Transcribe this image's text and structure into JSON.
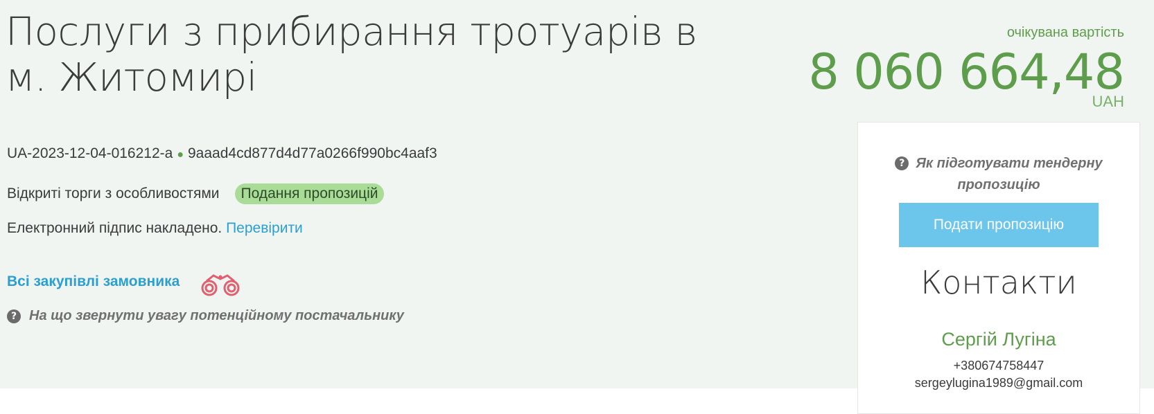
{
  "tender": {
    "title": "Послуги з прибирання тротуарів в м. Житомирі",
    "tender_id": "UA-2023-12-04-016212-a",
    "hash": "9aaad4cd877d4d77a0266f990bc4aaf3",
    "procedure_type": "Відкриті торги з особливостями",
    "status": "Подання пропозицій",
    "signature_text": "Електронний підпис накладено.",
    "signature_check_link": "Перевірити",
    "customer_purchases_link": "Всі закупівлі замовника",
    "supplier_hint": "На що звернути увагу потенційному постачальнику"
  },
  "price": {
    "label": "очікувана вартість",
    "value": "8 060 664,48",
    "currency": "UAH"
  },
  "panel": {
    "hint": "Як підготувати тендерну пропозицію",
    "submit_label": "Подати пропозицію",
    "contacts_title": "Контакти",
    "contact_name": "Сергій Лугіна",
    "contact_phone": "+380674758447",
    "contact_email": "sergeylugina1989@gmail.com"
  },
  "icons": {
    "help": "question-circle-icon",
    "watch": "binoculars-icon"
  },
  "colors": {
    "background": "#f0f5f1",
    "price_green": "#5e9d4c",
    "link_blue": "#2b9fd0",
    "status_badge": "#a8dc97",
    "submit_button": "#6cc5eb",
    "binoculars": "#e06070"
  }
}
